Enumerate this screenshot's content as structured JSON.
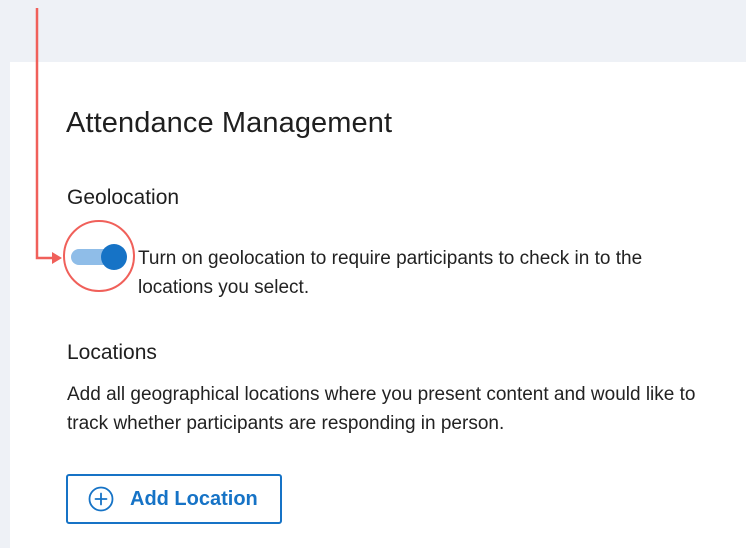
{
  "page": {
    "title": "Attendance Management"
  },
  "geolocation": {
    "heading": "Geolocation",
    "toggle_state": "on",
    "description": "Turn on geolocation to require participants to check in to the locations you select."
  },
  "locations": {
    "heading": "Locations",
    "description": "Add all geographical locations where you present content and would like to track whether participants are responding in person.",
    "add_button_label": "Add Location",
    "add_button_icon": "plus-circle-icon"
  },
  "colors": {
    "accent": "#1673c6",
    "toggle_track": "#8fbde8",
    "annotation": "#f0605a",
    "background": "#eef1f6"
  }
}
